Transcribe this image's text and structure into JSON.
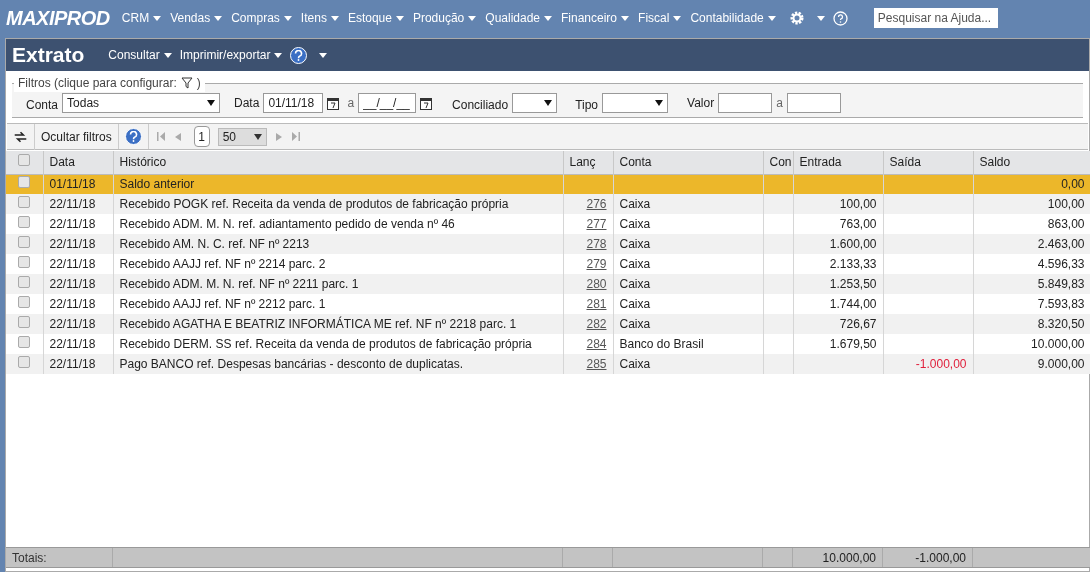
{
  "brand": "MAXIPROD",
  "menu": [
    {
      "label": "CRM"
    },
    {
      "label": "Vendas"
    },
    {
      "label": "Compras"
    },
    {
      "label": "Itens"
    },
    {
      "label": "Estoque"
    },
    {
      "label": "Produção"
    },
    {
      "label": "Qualidade"
    },
    {
      "label": "Financeiro"
    },
    {
      "label": "Fiscal"
    },
    {
      "label": "Contabilidade"
    }
  ],
  "help_search": {
    "placeholder": "Pesquisar na Ajuda..."
  },
  "page_title": "Extrato",
  "page_menu": [
    {
      "label": "Consultar"
    },
    {
      "label": "Imprimir/exportar"
    }
  ],
  "filters": {
    "legend": "Filtros (clique para configurar:",
    "legend_end": ")",
    "conta": {
      "label": "Conta",
      "value": "Todas"
    },
    "data": {
      "label": "Data",
      "from": "01/11/18",
      "sep": "a",
      "to": "__/__/__"
    },
    "conciliado": {
      "label": "Conciliado"
    },
    "tipo": {
      "label": "Tipo"
    },
    "valor": {
      "label": "Valor",
      "sep": "a"
    }
  },
  "toolbar": {
    "hide_filters": "Ocultar filtros",
    "page": "1",
    "page_size": "50"
  },
  "table": {
    "all_checked": false,
    "columns": [
      "Data",
      "Histórico",
      "Lanç",
      "Conta",
      "Con",
      "Entrada",
      "Saída",
      "Saldo"
    ],
    "rows": [
      {
        "selected": true,
        "checked": false,
        "data": "01/11/18",
        "historico": "Saldo anterior",
        "lanc": "",
        "conta": "",
        "entrada": "",
        "saida": "",
        "saldo": "0,00"
      },
      {
        "selected": false,
        "checked": false,
        "data": "22/11/18",
        "historico": "Recebido POGK ref. Receita da venda de produtos de fabricação própria",
        "lanc": "276",
        "conta": "Caixa",
        "entrada": "100,00",
        "saida": "",
        "saldo": "100,00"
      },
      {
        "selected": false,
        "checked": false,
        "data": "22/11/18",
        "historico": "Recebido ADM. M. N. ref. adiantamento pedido de venda nº 46",
        "lanc": "277",
        "conta": "Caixa",
        "entrada": "763,00",
        "saida": "",
        "saldo": "863,00"
      },
      {
        "selected": false,
        "checked": false,
        "data": "22/11/18",
        "historico": "Recebido AM. N. C. ref. NF nº 2213",
        "lanc": "278",
        "conta": "Caixa",
        "entrada": "1.600,00",
        "saida": "",
        "saldo": "2.463,00"
      },
      {
        "selected": false,
        "checked": false,
        "data": "22/11/18",
        "historico": "Recebido AAJJ ref. NF nº 2214 parc. 2",
        "lanc": "279",
        "conta": "Caixa",
        "entrada": "2.133,33",
        "saida": "",
        "saldo": "4.596,33"
      },
      {
        "selected": false,
        "checked": false,
        "data": "22/11/18",
        "historico": "Recebido ADM. M. N. ref. NF nº 2211 parc. 1",
        "lanc": "280",
        "conta": "Caixa",
        "entrada": "1.253,50",
        "saida": "",
        "saldo": "5.849,83"
      },
      {
        "selected": false,
        "checked": false,
        "data": "22/11/18",
        "historico": "Recebido AAJJ ref. NF nº 2212 parc. 1",
        "lanc": "281",
        "conta": "Caixa",
        "entrada": "1.744,00",
        "saida": "",
        "saldo": "7.593,83"
      },
      {
        "selected": false,
        "checked": false,
        "data": "22/11/18",
        "historico": "Recebido AGATHA E BEATRIZ INFORMÁTICA ME ref. NF nº 2218 parc. 1",
        "lanc": "282",
        "conta": "Caixa",
        "entrada": "726,67",
        "saida": "",
        "saldo": "8.320,50"
      },
      {
        "selected": false,
        "checked": false,
        "data": "22/11/18",
        "historico": "Recebido DERM. SS ref. Receita da venda de produtos de fabricação própria",
        "lanc": "284",
        "conta": "Banco do Brasil",
        "entrada": "1.679,50",
        "saida": "",
        "saldo": "10.000,00"
      },
      {
        "selected": false,
        "checked": false,
        "data": "22/11/18",
        "historico": "Pago BANCO ref. Despesas bancárias - desconto de duplicatas.",
        "lanc": "285",
        "conta": "Caixa",
        "entrada": "",
        "saida": "-1.000,00",
        "saldo": "9.000,00"
      }
    ],
    "totals": {
      "label": "Totais:",
      "entrada": "10.000,00",
      "saida": "-1.000,00"
    }
  }
}
